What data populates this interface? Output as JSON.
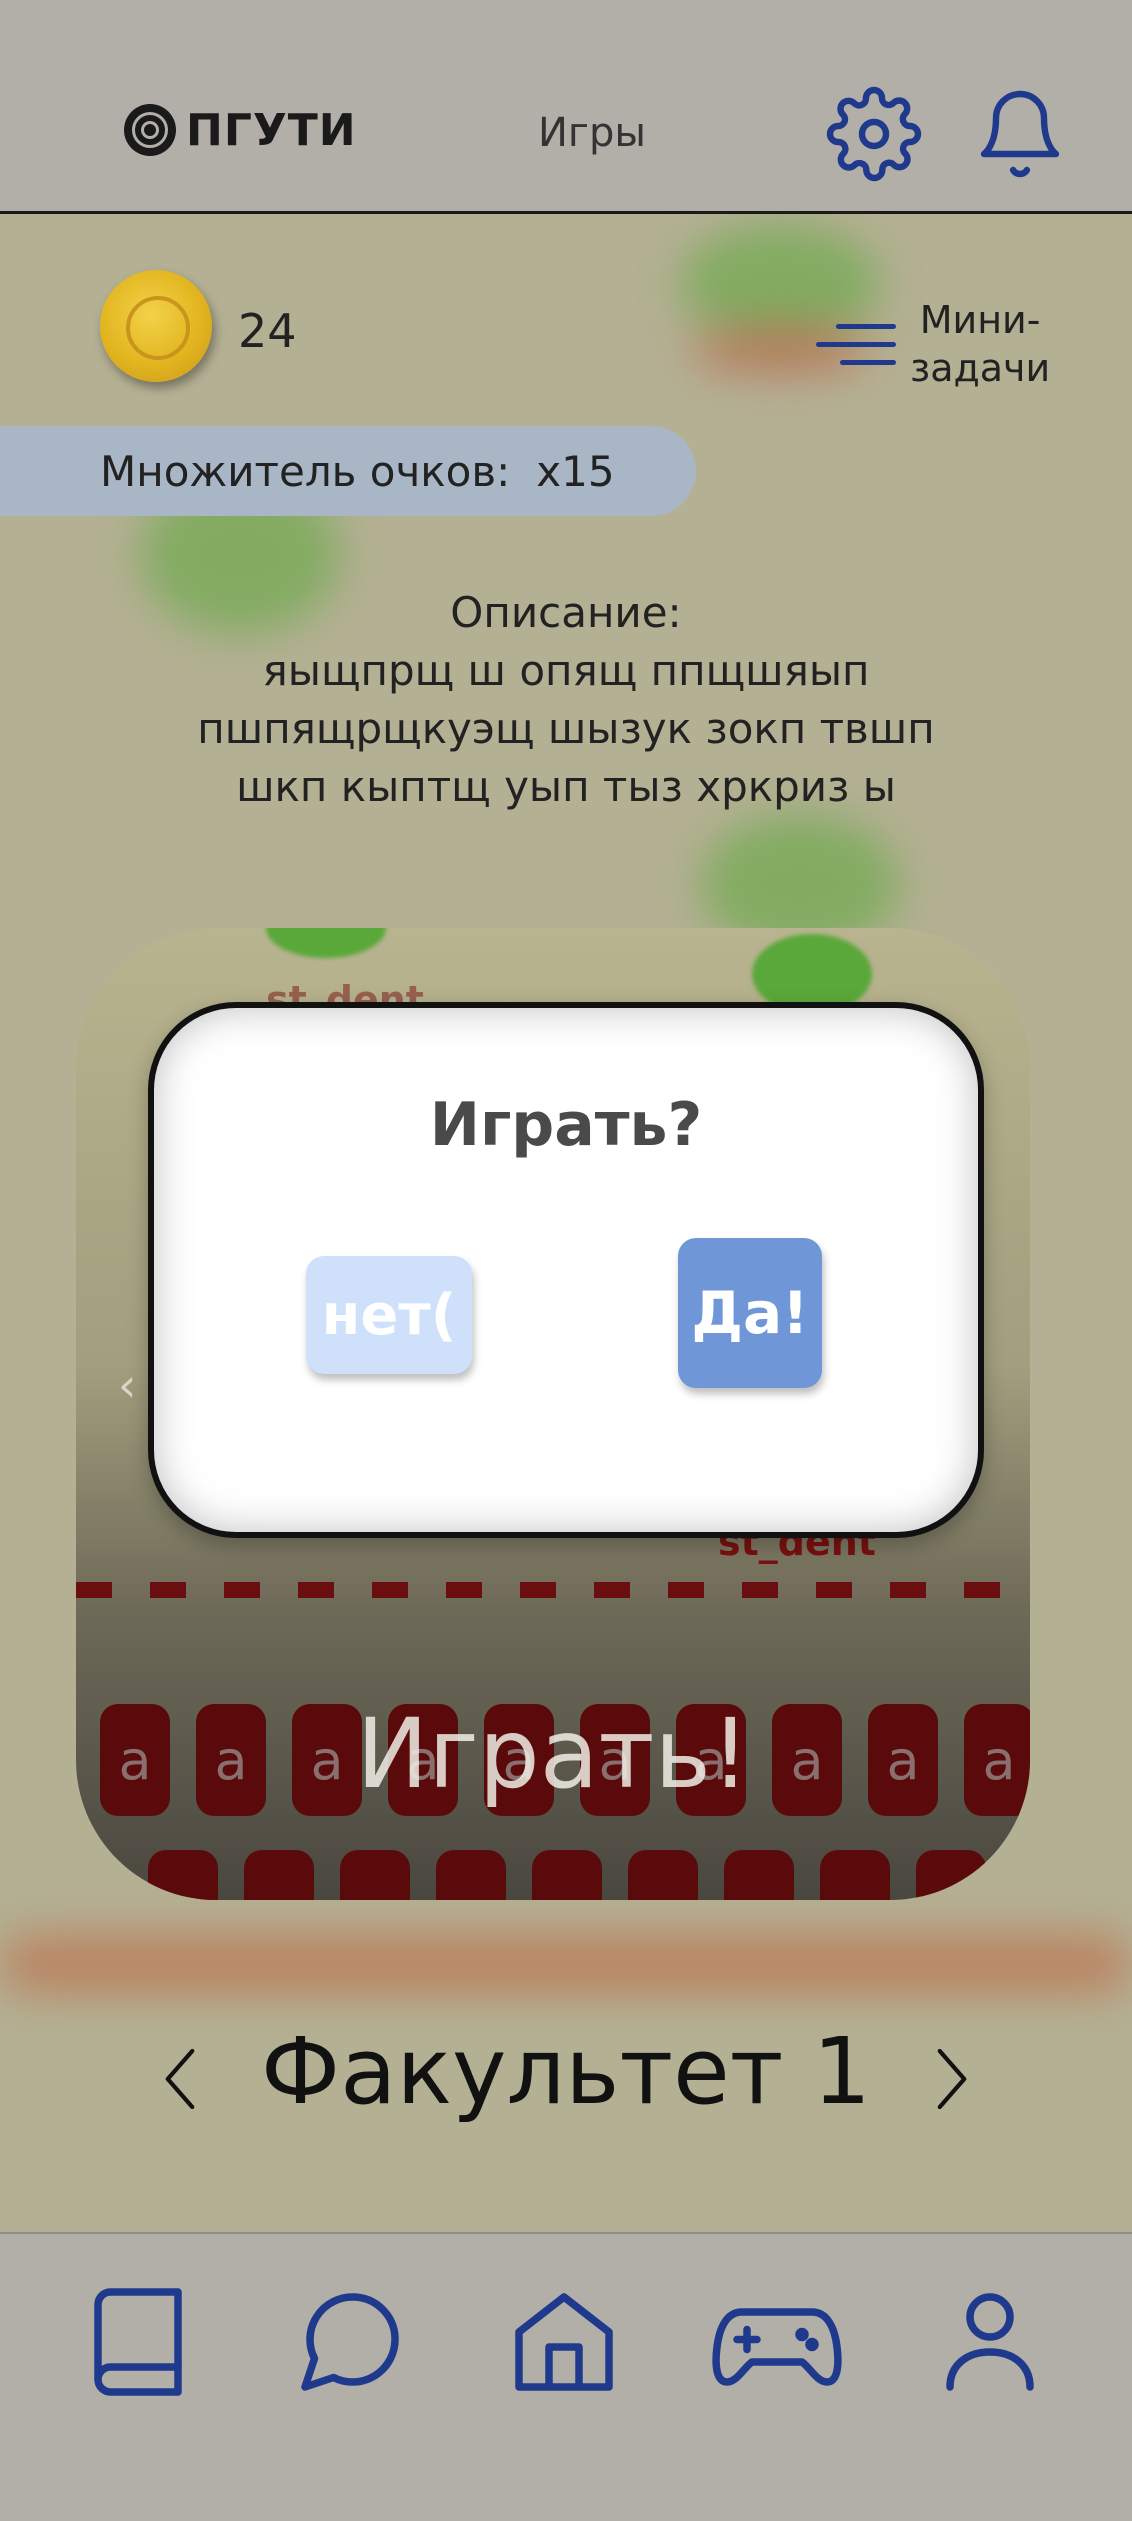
{
  "header": {
    "logo_text": "ПГУТИ",
    "title": "Игры",
    "icons": [
      "settings-gear-icon",
      "notification-bell-icon"
    ]
  },
  "wallet": {
    "coin_icon": "gold-coin-icon",
    "coins": "24"
  },
  "mini_tasks": {
    "icon": "menu-lines-icon",
    "label_line1": "Мини-",
    "label_line2": "задачи"
  },
  "multiplier": {
    "label": "Множитель очков:",
    "value": "x15"
  },
  "description": {
    "heading": "Описание:",
    "line1": "яыщпрщ ш опящ ппщшяып",
    "line2": "пшпящрщкуэщ шызук  зокп твшп",
    "line3": "шкп кыптщ уып тыз хркриз ы"
  },
  "game_card": {
    "label_top": "st_dent",
    "label_bottom": "st_dent",
    "key_letter": "a",
    "play_label": "Играть!"
  },
  "dialog": {
    "title": "Играть?",
    "no_label": "нет(",
    "yes_label": "Да!"
  },
  "faculty": {
    "name": "Факультет 1",
    "prev_icon": "chevron-left-icon",
    "next_icon": "chevron-right-icon"
  },
  "bottom_nav": {
    "items": [
      "book-icon",
      "chat-icon",
      "home-icon",
      "gamepad-icon",
      "profile-icon"
    ]
  },
  "colors": {
    "accent": "#1f3a8c",
    "header_bg": "#b2aea8",
    "page_bg": "#b4b093",
    "pill_bg": "#a9b6c6",
    "yes_button": "#6f96d6",
    "no_button": "#cfe0fb"
  }
}
